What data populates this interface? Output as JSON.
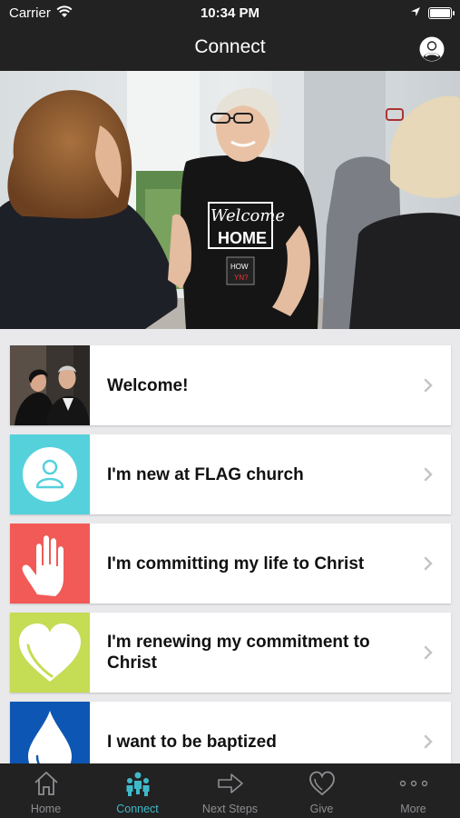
{
  "status_bar": {
    "carrier": "Carrier",
    "time": "10:34 PM"
  },
  "nav": {
    "title": "Connect",
    "profile_icon": "user-circle-icon"
  },
  "hero": {
    "description": "greeting-photo",
    "shirt_text": "Welcome HOME"
  },
  "items": [
    {
      "label": "Welcome!",
      "icon": "photo-couple",
      "color": "#2b2b2b"
    },
    {
      "label": "I'm new at FLAG church",
      "icon": "person-icon",
      "color": "#55d1dc"
    },
    {
      "label": "I'm committing my life to Christ",
      "icon": "hand-icon",
      "color": "#f15a57"
    },
    {
      "label": "I'm renewing my commitment to Christ",
      "icon": "heart-icon",
      "color": "#c5dc55"
    },
    {
      "label": "I want to be baptized",
      "icon": "water-drop-icon",
      "color": "#0d56b3"
    }
  ],
  "tabs": [
    {
      "label": "Home",
      "icon": "home-icon",
      "active": false
    },
    {
      "label": "Connect",
      "icon": "people-icon",
      "active": true
    },
    {
      "label": "Next Steps",
      "icon": "arrow-right-icon",
      "active": false
    },
    {
      "label": "Give",
      "icon": "heart-icon",
      "active": false
    },
    {
      "label": "More",
      "icon": "more-icon",
      "active": false
    }
  ],
  "colors": {
    "bar": "#222222",
    "accent": "#3fb9c9",
    "background": "#e9e9ec"
  }
}
